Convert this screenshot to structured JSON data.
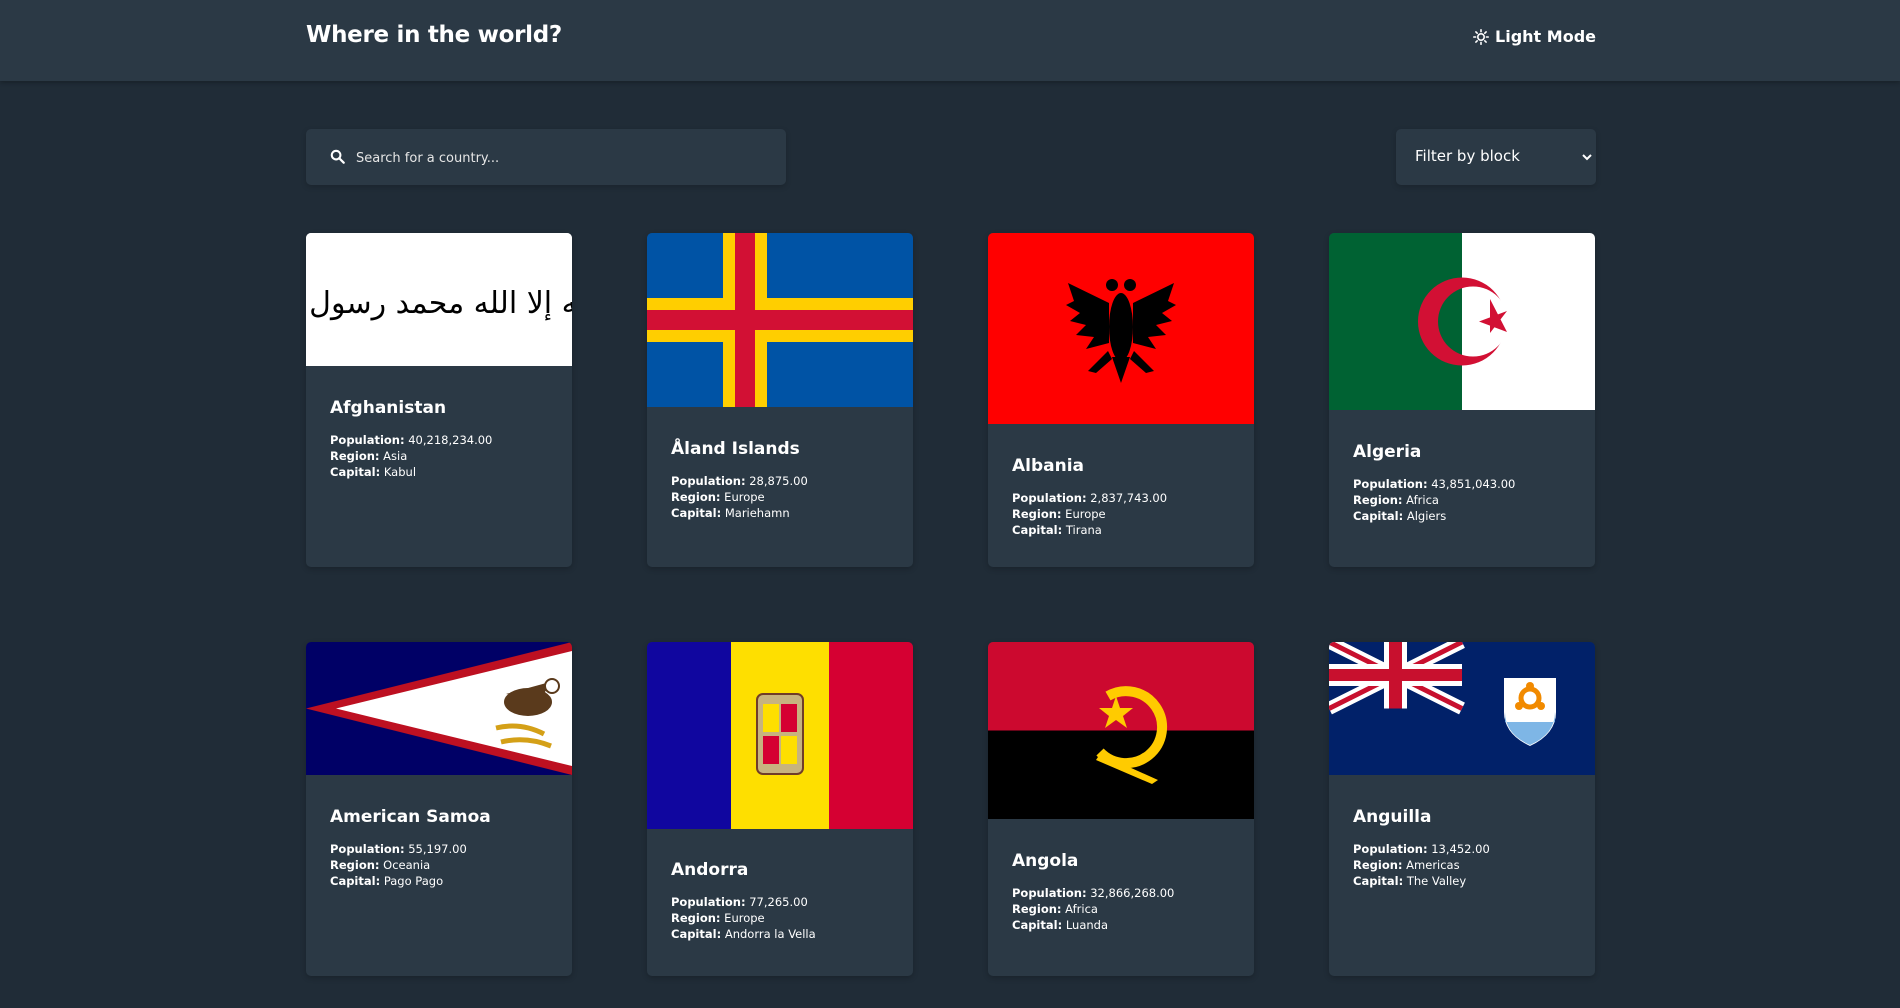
{
  "header": {
    "title": "Where in the world?",
    "mode_label": "Light Mode"
  },
  "search": {
    "placeholder": "Search for a country..."
  },
  "filter": {
    "label": "Filter by block"
  },
  "labels": {
    "population": "Population:",
    "region": "Region:",
    "capital": "Capital:"
  },
  "countries": [
    {
      "name": "Afghanistan",
      "population": "40,218,234.00",
      "region": "Asia",
      "capital": "Kabul",
      "flag_alt": "لا إله إلا الله محمد رسول الله"
    },
    {
      "name": "Åland Islands",
      "population": "28,875.00",
      "region": "Europe",
      "capital": "Mariehamn"
    },
    {
      "name": "Albania",
      "population": "2,837,743.00",
      "region": "Europe",
      "capital": "Tirana"
    },
    {
      "name": "Algeria",
      "population": "43,851,043.00",
      "region": "Africa",
      "capital": "Algiers"
    },
    {
      "name": "American Samoa",
      "population": "55,197.00",
      "region": "Oceania",
      "capital": "Pago Pago"
    },
    {
      "name": "Andorra",
      "population": "77,265.00",
      "region": "Europe",
      "capital": "Andorra la Vella"
    },
    {
      "name": "Angola",
      "population": "32,866,268.00",
      "region": "Africa",
      "capital": "Luanda"
    },
    {
      "name": "Anguilla",
      "population": "13,452.00",
      "region": "Americas",
      "capital": "The Valley"
    }
  ]
}
